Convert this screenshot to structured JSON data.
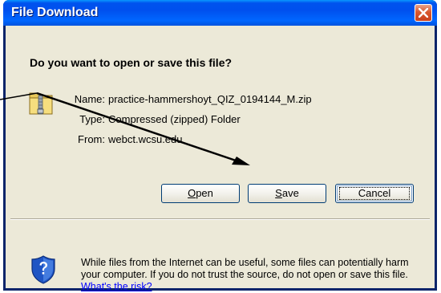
{
  "window": {
    "title": "File Download"
  },
  "dialog": {
    "question": "Do you want to open or save this file?",
    "file": {
      "name_label": "Name:",
      "name_value": "practice-hammershoyt_QIZ_0194144_M.zip",
      "type_label": "Type:",
      "type_value": "Compressed (zipped) Folder",
      "from_label": "From:",
      "from_value": "webct.wcsu.edu"
    },
    "buttons": {
      "open_accel": "O",
      "open_rest": "pen",
      "save_accel": "S",
      "save_rest": "ave",
      "cancel": "Cancel"
    },
    "warning": {
      "text": "While files from the Internet can be useful, some files can potentially harm your computer. If you do not trust the source, do not open or save this file.",
      "link": "What's the risk?"
    }
  },
  "icons": {
    "close": "close-icon",
    "file": "zip-folder-icon",
    "warning": "security-shield-icon"
  },
  "colors": {
    "titlebar": "#0053ee",
    "dialog_bg": "#ece9d8",
    "close_button": "#d9582e",
    "link": "#0000ff"
  }
}
